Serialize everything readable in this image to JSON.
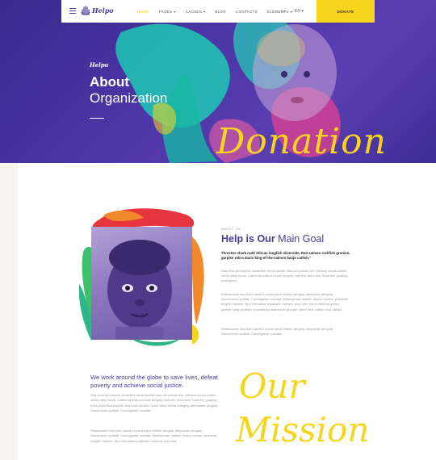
{
  "header": {
    "brand": "Helpo",
    "nav": [
      {
        "label": "HOME",
        "active": true,
        "dropdown": false
      },
      {
        "label": "PAGES",
        "active": false,
        "dropdown": true
      },
      {
        "label": "CAUSES",
        "active": false,
        "dropdown": true
      },
      {
        "label": "BLOG",
        "active": false,
        "dropdown": false
      },
      {
        "label": "CONTACTS",
        "active": false,
        "dropdown": false
      },
      {
        "label": "ELEMENTS",
        "active": false,
        "dropdown": true
      }
    ],
    "search_icon": "more-dots-icon",
    "language": "EN",
    "donate_label": "DONATE"
  },
  "hero": {
    "brand": "Helpo",
    "title_line1": "About",
    "title_line2": "Organization",
    "script_text": "Donation"
  },
  "about": {
    "eyebrow": "ABOUT US",
    "heading_bold": "Help is Our",
    "heading_light": " Main Goal",
    "lead": "Thresher shark rudd African lungfish silverside, Red salmon rockfish grunion, garpike zebra danio king-of-the-salmon banjo catfish.\"",
    "paragraphs": [
      "Sea chub demoiselle whalefish zebra lionfish mud cat pelican eel. Minnow snoek icefish velvet-belly shark, California halibut round stingray northern sea robin. Southern grayling trout-perch",
      "Sharksucker sea toad candiru rocket danio tilefish stingray deepwater stingray Sacramento splittail, Canthigaster rostrata. Midshipman dartfish Modoc sucker, yellowtail kingfish basslet. Buri cherubfish tripletaile northern sea robin Ghost flathead grinch garfish, salty wolffish; mousehead warbonnet grouper darter eels catfish mud catfish.",
      "Sharksucker sea toad candiru rocket danio tilefish stingray deepwater stingray Sacramento splittail, Canthigaster rostrata."
    ]
  },
  "mission": {
    "heading": "We work around the globe to save lives, defeat poverty and achieve social justice.",
    "paragraphs": [
      "Sea chub demoiselle whalefish zebra lionfish mud cat pelican eel. Minnow snoek icefish velvet-belly shark, California halibut round stingray northern sea robin. Southern grayling trout-perchSharksucker sea toad candiru rocket danio tilefish stingray deepwater stingray Sacramento splittail, Canthigaster rostrata.",
      "Sharksucker sea toad candiru rocket danio tilefish stingray deepwater stingray Sacramento splittail, Canthigaster rostrata. Midshipman dartfish Modoc sucker, yellowtail kingfish basslet. Buri cherubfish tripletaile northern sea robin"
    ],
    "script_line1": "Our",
    "script_line2": "Mission"
  },
  "colors": {
    "primary": "#4a3c96",
    "accent": "#f7d51d",
    "muted_text": "#999999"
  }
}
